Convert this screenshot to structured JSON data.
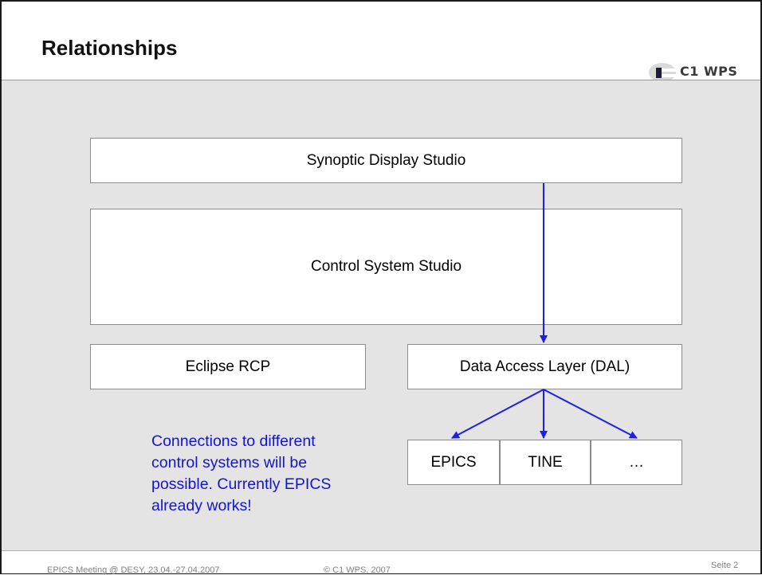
{
  "slide": {
    "title": "Relationships",
    "logo_text": "C1 WPS"
  },
  "diagram": {
    "synoptic": "Synoptic Display Studio",
    "css": "Control System Studio",
    "eclipse": "Eclipse RCP",
    "dal": "Data Access Layer (DAL)",
    "epics": "EPICS",
    "tine": "TINE",
    "more": "…"
  },
  "note": {
    "line1": "Connections to different",
    "line2": "control systems will be",
    "line3": "possible. Currently EPICS",
    "line4": "already works!"
  },
  "footer": {
    "event": "EPICS Meeting @ DESY, 23.04.-27.04.2007",
    "copyright": "© C1 WPS, 2007",
    "page": "Seite 2"
  },
  "colors": {
    "arrow": "#1e1ee6",
    "note_text": "#1414d2",
    "content_bg": "#e4e4e4"
  }
}
